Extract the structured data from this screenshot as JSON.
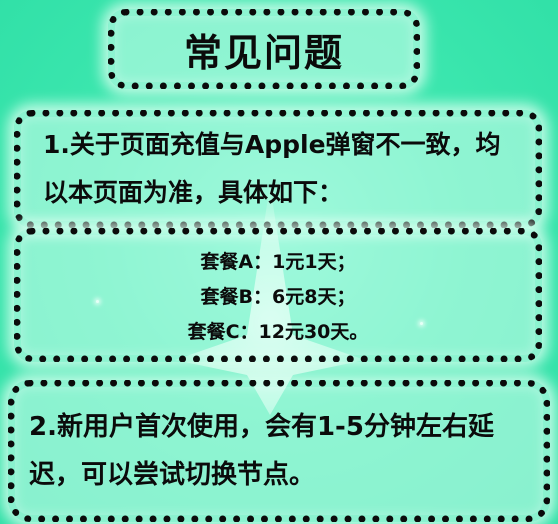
{
  "title": "常见问题",
  "faq1": {
    "text": "1.关于页面充值与Apple弹窗不一致，均以本页面为准，具体如下："
  },
  "plans": [
    "套餐A：1元1天；",
    "套餐B：6元8天；",
    "套餐C：12元30天。"
  ],
  "faq2": {
    "text": "2.新用户首次使用，会有1-5分钟左右延迟，可以尝试切换节点。"
  },
  "colors": {
    "background": "#3ee8b0",
    "box_fill": "#d2ffee",
    "dots": "#0b0b0b",
    "glow": "#dcfff0",
    "text": "#0b0b0b"
  },
  "icons": [
    "star-decoration"
  ]
}
